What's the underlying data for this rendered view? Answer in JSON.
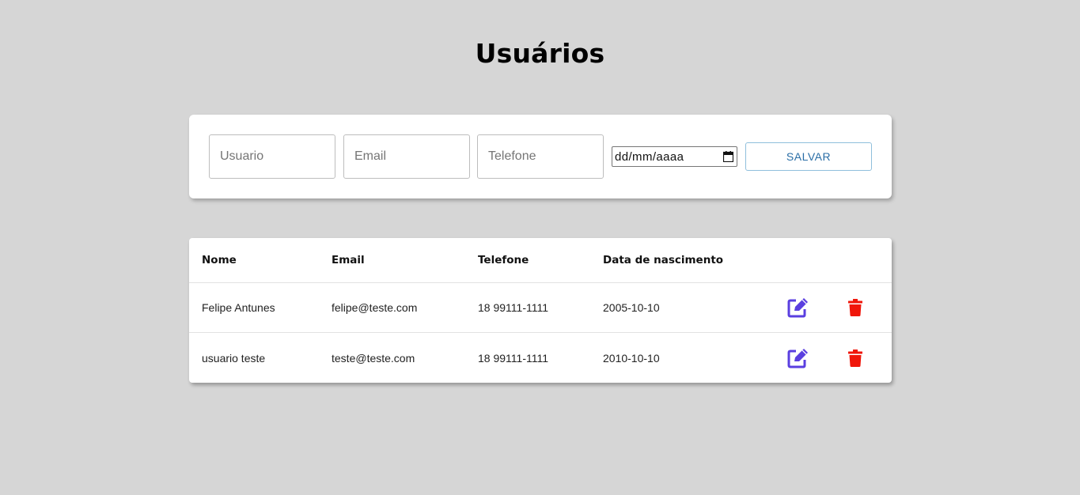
{
  "page": {
    "title": "Usuários"
  },
  "form": {
    "usuario_placeholder": "Usuario",
    "email_placeholder": "Email",
    "telefone_placeholder": "Telefone",
    "date_placeholder": "dd/mm/aaaa",
    "save_label": "SALVAR"
  },
  "table": {
    "headers": {
      "nome": "Nome",
      "email": "Email",
      "telefone": "Telefone",
      "data": "Data de nascimento"
    },
    "rows": [
      {
        "nome": "Felipe Antunes",
        "email": "felipe@teste.com",
        "telefone": "18 99111-1111",
        "data": "2005-10-10"
      },
      {
        "nome": "usuario teste",
        "email": "teste@teste.com",
        "telefone": "18 99111-1111",
        "data": "2010-10-10"
      }
    ]
  },
  "icons": {
    "edit": "edit-icon",
    "delete": "trash-icon"
  },
  "colors": {
    "background": "#d6d6d6",
    "edit_icon": "#5a3fe0",
    "delete_icon": "#f0160a",
    "save_text": "#2a6ea6",
    "save_border": "#8fbfdc"
  }
}
